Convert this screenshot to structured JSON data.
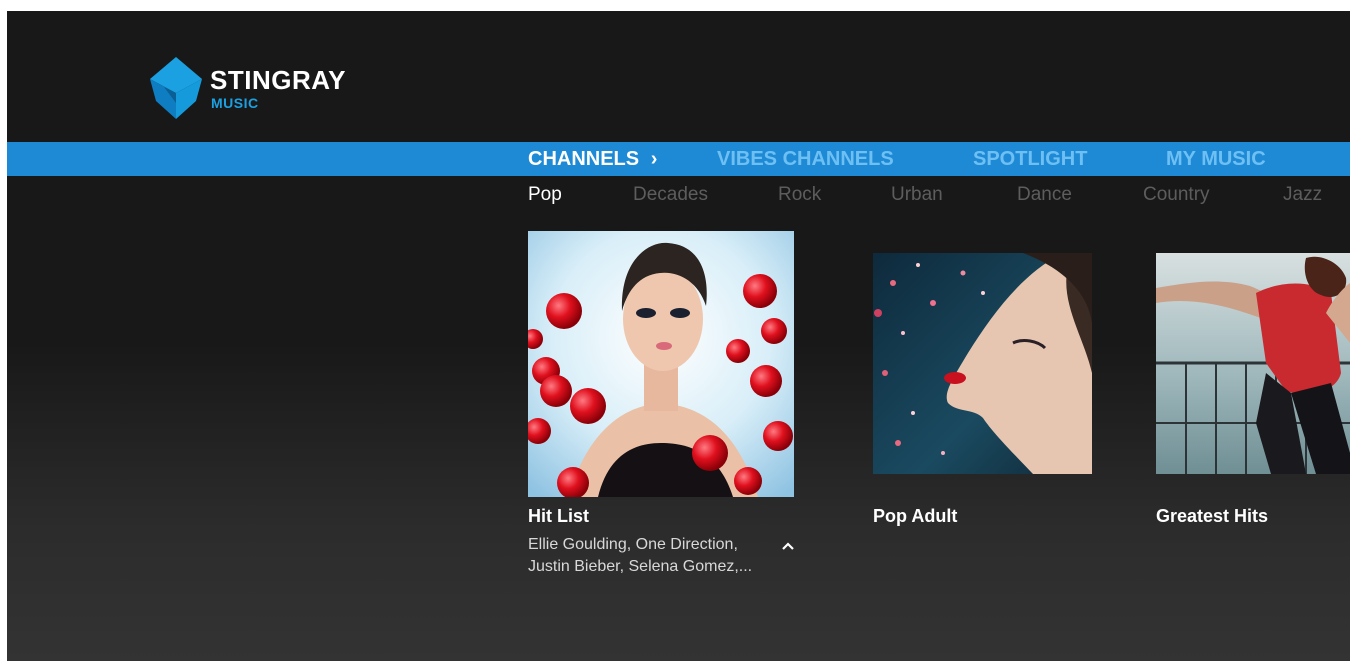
{
  "app": {
    "logo": {
      "brand": "STINGRAY",
      "sub": "MUSIC"
    },
    "colors": {
      "accent": "#1e8ad6",
      "logo_blue": "#1ba1e2",
      "background": "#181818"
    }
  },
  "nav": {
    "tabs": [
      {
        "label": "CHANNELS",
        "active": true,
        "icon": "chevron-right-icon"
      },
      {
        "label": "VIBES CHANNELS",
        "active": false
      },
      {
        "label": "SPOTLIGHT",
        "active": false
      },
      {
        "label": "MY MUSIC",
        "active": false
      }
    ],
    "chevron": "›"
  },
  "subnav": {
    "items": [
      {
        "label": "Pop",
        "active": true
      },
      {
        "label": "Decades",
        "active": false
      },
      {
        "label": "Rock",
        "active": false
      },
      {
        "label": "Urban",
        "active": false
      },
      {
        "label": "Dance",
        "active": false
      },
      {
        "label": "Country",
        "active": false
      },
      {
        "label": "Jazz",
        "active": false
      }
    ]
  },
  "channels": [
    {
      "title": "Hit List",
      "desc_line1": "Ellie Goulding, One Direction,",
      "desc_line2": "Justin Bieber, Selena Gomez,...",
      "expanded": true,
      "icon": "chevron-up-icon"
    },
    {
      "title": "Pop Adult"
    },
    {
      "title": "Greatest Hits"
    }
  ]
}
